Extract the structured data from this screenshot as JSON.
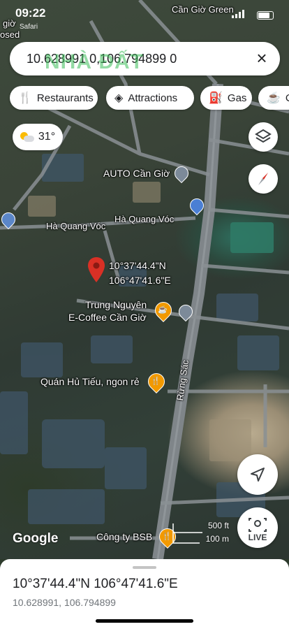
{
  "status_bar": {
    "time": "09:22",
    "back_app": "Safari",
    "carrier_label": "Cần Giờ Green"
  },
  "search": {
    "query": "10.628991 0,106.794899 0"
  },
  "watermark": "NHÀ ĐẤT",
  "chips": [
    {
      "icon": "restaurant-icon",
      "label": "Restaurants"
    },
    {
      "icon": "attractions-icon",
      "label": "Attractions"
    },
    {
      "icon": "gas-icon",
      "label": "Gas"
    },
    {
      "icon": "coffee-icon",
      "label": "C"
    }
  ],
  "weather": {
    "temp": "31°"
  },
  "map_labels": {
    "auto": "AUTO Cần Giờ",
    "road1": "Hà Quang Vóc",
    "road2": "Hà Quang Vóc",
    "pin_dms_1": "10°37'44.4\"N",
    "pin_dms_2": "106°47'41.6\"E",
    "cafe_1": "Trung Nguyên",
    "cafe_2": "E-Coffee Cần Giờ",
    "food": "Quán Hủ Tiếu, ngon rẻ",
    "street": "Rừng Sác",
    "company": "Công ty BSB",
    "left_top": "giờ",
    "left_top2": "osed",
    "google": "Google",
    "scale_ft": "500 ft",
    "scale_m": "100 m"
  },
  "live_button": {
    "label": "LIVE"
  },
  "sheet": {
    "dms": "10°37'44.4\"N 106°47'41.6\"E",
    "decimal": "10.628991, 106.794899"
  },
  "colors": {
    "pin": "#d93025",
    "food_pin": "#f29900",
    "chip_bg": "#ffffff"
  }
}
